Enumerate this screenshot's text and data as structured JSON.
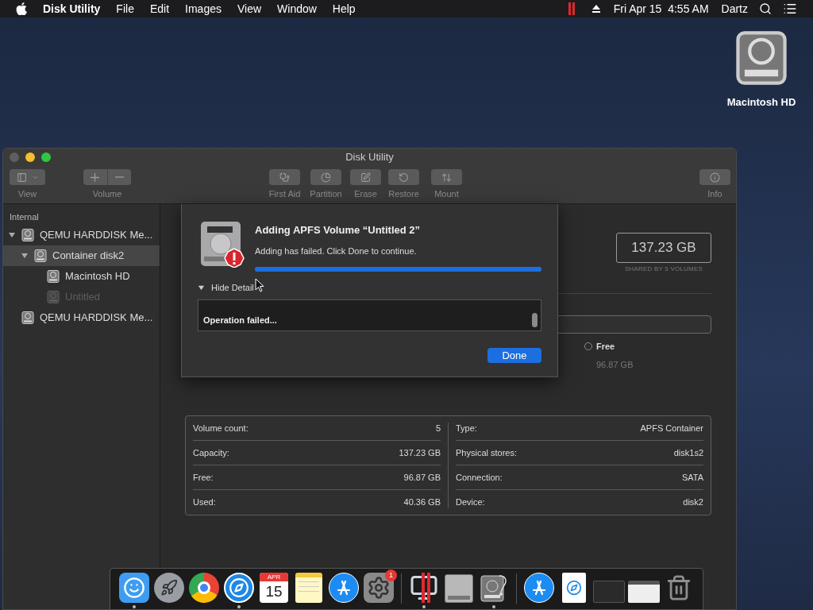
{
  "menu_bar": {
    "app_name": "Disk Utility",
    "menus": [
      "File",
      "Edit",
      "Images",
      "View",
      "Window",
      "Help"
    ],
    "clock": "Fri Apr 15  4:55 AM",
    "user": "Dartz"
  },
  "desktop_icons": [
    {
      "label": "Macintosh HD"
    }
  ],
  "window": {
    "title": "Disk Utility",
    "toolbar": [
      {
        "kind": "view",
        "label": "View"
      },
      {
        "kind": "volume",
        "label": "Volume"
      },
      {
        "kind": "first-aid",
        "label": "First Aid"
      },
      {
        "kind": "partition",
        "label": "Partition"
      },
      {
        "kind": "erase",
        "label": "Erase"
      },
      {
        "kind": "restore",
        "label": "Restore"
      },
      {
        "kind": "mount",
        "label": "Mount"
      },
      {
        "kind": "info",
        "label": "Info"
      }
    ],
    "sidebar": {
      "section": "Internal",
      "items": [
        {
          "label": "QEMU HARDDISK Me...",
          "expanded": true,
          "selected": false,
          "disabled": false,
          "children": [
            {
              "label": "Container disk2",
              "expanded": true,
              "selected": true,
              "disabled": false,
              "children": [
                {
                  "label": "Macintosh HD",
                  "selected": false,
                  "disabled": false
                },
                {
                  "label": "Untitled",
                  "selected": false,
                  "disabled": true
                }
              ]
            }
          ]
        },
        {
          "label": "QEMU HARDDISK Me...",
          "selected": false,
          "disabled": false
        }
      ]
    },
    "overview": {
      "capacity": "137.23 GB",
      "capacity_caption": "SHARED BY 5 VOLUMES",
      "legend": [
        {
          "label": "Free",
          "value": "96.87 GB"
        }
      ]
    },
    "info": {
      "left": [
        {
          "label": "Volume count:",
          "value": "5"
        },
        {
          "label": "Capacity:",
          "value": "137.23 GB"
        },
        {
          "label": "Free:",
          "value": "96.87 GB"
        },
        {
          "label": "Used:",
          "value": "40.36 GB"
        }
      ],
      "right": [
        {
          "label": "Type:",
          "value": "APFS Container"
        },
        {
          "label": "Physical stores:",
          "value": "disk1s2"
        },
        {
          "label": "Connection:",
          "value": "SATA"
        },
        {
          "label": "Device:",
          "value": "disk2"
        }
      ]
    },
    "sheet": {
      "title": "Adding APFS Volume “Untitled 2”",
      "message": "Adding has failed. Click Done to continue.",
      "progress": {
        "level": 1
      },
      "details_toggle": {
        "label": "Hide Detail",
        "expanded": true
      },
      "log": [
        "Operation failed..."
      ],
      "button": "Done"
    }
  },
  "dock": {
    "items": [
      {
        "kind": "finder",
        "running": true
      },
      {
        "kind": "launchpad",
        "running": false
      },
      {
        "kind": "chrome",
        "running": false
      },
      {
        "kind": "safari",
        "running": true
      },
      {
        "kind": "calendar",
        "running": false,
        "month": "APR",
        "day": "15"
      },
      {
        "kind": "notes",
        "running": false
      },
      {
        "kind": "app-store",
        "running": false
      },
      {
        "kind": "settings",
        "running": false,
        "badge": "1"
      },
      {
        "kind": "separator"
      },
      {
        "kind": "parallels",
        "running": true
      },
      {
        "kind": "drive",
        "running": false
      },
      {
        "kind": "disk-utility",
        "running": true
      },
      {
        "kind": "separator"
      },
      {
        "kind": "app-store",
        "running": false
      },
      {
        "kind": "document",
        "running": false
      },
      {
        "kind": "terminal-window",
        "running": false
      },
      {
        "kind": "browser-window",
        "running": false
      },
      {
        "kind": "trash",
        "running": false
      }
    ]
  }
}
